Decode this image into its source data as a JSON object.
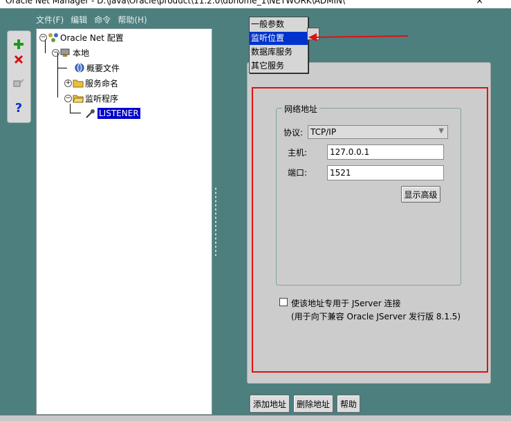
{
  "window": {
    "title": "Oracle Net Manager - D:\\java\\Oracle\\product\\11.2.0\\dbhome_1\\NETWORK\\ADMIN\\"
  },
  "menu": [
    "文件(F)",
    "编辑",
    "命令",
    "帮助(H)"
  ],
  "toolbar": {
    "add_icon": "plus-icon",
    "delete_icon": "x-icon",
    "test_icon": "test-icon",
    "help_icon": "question-icon",
    "colors": {
      "add": "#1a9a1a",
      "delete": "#d01010",
      "help": "#1030c0"
    }
  },
  "tree": {
    "root": "Oracle Net 配置",
    "local": "本地",
    "profile": "概要文件",
    "service_naming": "服务命名",
    "listeners": "监听程序",
    "listener": "LISTENER"
  },
  "dropdown": {
    "items": [
      "一般参数",
      "监听位置",
      "数据库服务",
      "其它服务"
    ],
    "selected_index": 1
  },
  "address": {
    "group_title": "网络地址",
    "protocol_label": "协议:",
    "protocol_value": "TCP/IP",
    "host_label": "主机:",
    "host_value": "127.0.0.1",
    "port_label": "端口:",
    "port_value": "1521",
    "advanced_button": "显示高级"
  },
  "jserver": {
    "checkbox_label": "使该地址专用于 JServer 连接",
    "note": "(用于向下兼容 Oracle JServer 发行版 8.1.5)",
    "checked": false
  },
  "footer_buttons": {
    "add": "添加地址",
    "delete": "删除地址",
    "help": "帮助"
  },
  "colors": {
    "background": "#4d7f7f",
    "selection": "#0033cc",
    "annotation_red": "#e01010"
  }
}
